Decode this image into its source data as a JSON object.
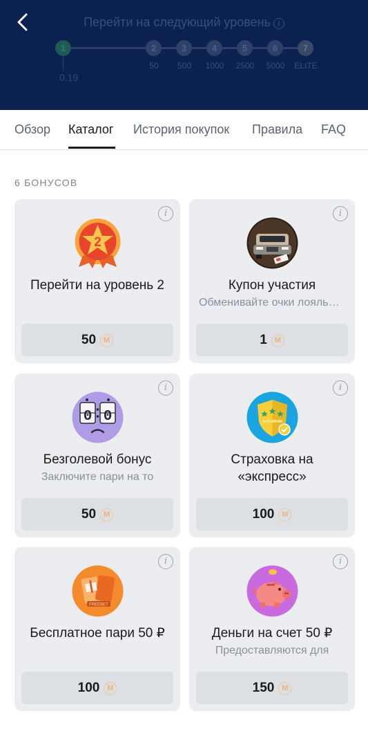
{
  "header": {
    "title": "Перейти на следующий уровень",
    "levels": [
      "1",
      "2",
      "3",
      "4",
      "5",
      "6",
      "7"
    ],
    "level_labels": [
      "50",
      "500",
      "1000",
      "2500",
      "5000",
      "ELITE"
    ],
    "progress": "0.19"
  },
  "tabs": [
    "Обзор",
    "Каталог",
    "История покупок",
    "Правила",
    "FAQ"
  ],
  "active_tab": "Каталог",
  "catalog": {
    "count_label": "6 БОНУСОВ",
    "items": [
      {
        "title": "Перейти на уровень 2",
        "subtitle": "",
        "price": "50",
        "icon": "level-2-badge-icon"
      },
      {
        "title": "Купон участия",
        "subtitle": "Обменивайте очки лояльности",
        "price": "1",
        "icon": "car-coupon-icon"
      },
      {
        "title": "Безголевой бонус",
        "subtitle": "Заключите пари на то",
        "price": "50",
        "icon": "scoreboard-icon"
      },
      {
        "title": "Страховка на «экспресс»",
        "subtitle": "",
        "price": "100",
        "icon": "shield-icon"
      },
      {
        "title": "Бесплатное пари 50 ₽",
        "subtitle": "",
        "price": "100",
        "icon": "gift-ticket-icon"
      },
      {
        "title": "Деньги на счет 50 ₽",
        "subtitle": "Предоставляются для",
        "price": "150",
        "icon": "piggy-bank-icon"
      }
    ]
  },
  "coin_symbol": "M",
  "colors": {
    "header_bg": "#0b2150",
    "card_bg": "#ebedf0",
    "price_bg": "#dcdfe3",
    "coin": "#f0b27a"
  }
}
